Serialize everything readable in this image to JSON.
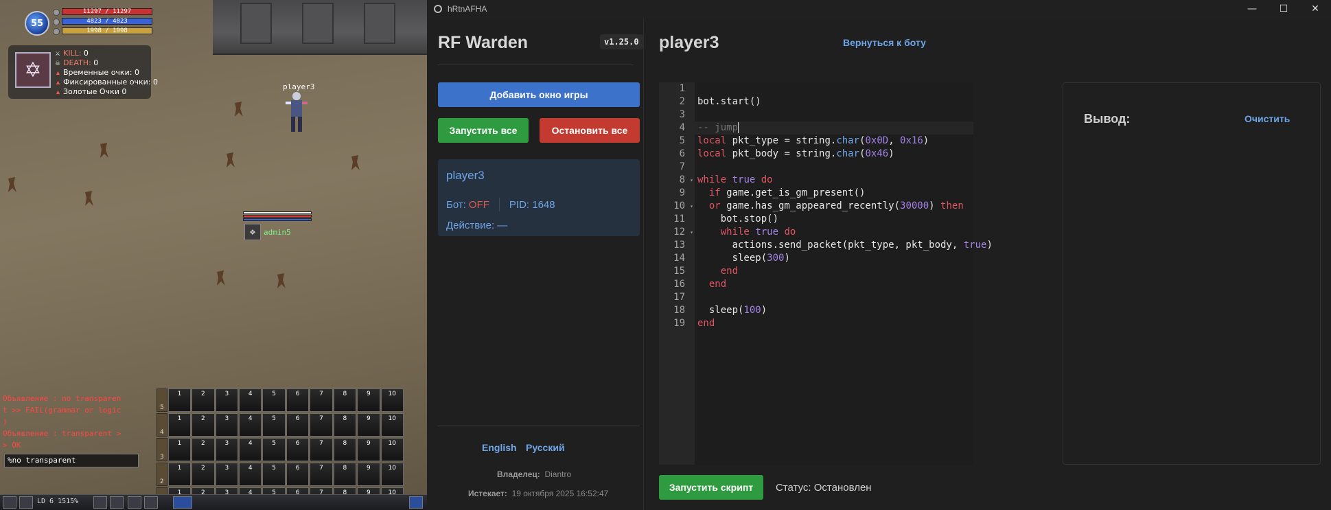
{
  "game": {
    "level": "55",
    "hp": "11297 / 11297",
    "fp": "4823 / 4823",
    "sp": "1998 / 1998",
    "stats": [
      {
        "label": "KILL:",
        "value": "0"
      },
      {
        "label": "DEATH:",
        "value": "0"
      },
      {
        "label": "Временные очки:",
        "value": "0"
      },
      {
        "label": "Фиксированные очки:",
        "value": "0"
      },
      {
        "label": "Золотые Очки",
        "value": "0"
      }
    ],
    "player_name": "player3",
    "admin_name": "admin5",
    "chat_lines": [
      "Объявление : no transparen",
      "t >> FAIL(grammar or logic",
      ")",
      "Объявление : transparent >",
      "> OK"
    ],
    "chat_input": "%no transparent",
    "hotbar_rows": [
      "5",
      "4",
      "3",
      "2",
      "1"
    ],
    "hotbar_slots": [
      "1",
      "2",
      "3",
      "4",
      "5",
      "6",
      "7",
      "8",
      "9",
      "10"
    ],
    "bottom_text": "LD 6 1515%"
  },
  "window": {
    "title": "hRtnAFHA",
    "controls": {
      "minimize": "—",
      "maximize": "☐",
      "close": "✕"
    }
  },
  "sidebar": {
    "brand": "RF Warden",
    "version": "v1.25.0",
    "add_window": "Добавить окно игры",
    "start_all": "Запустить все",
    "stop_all": "Остановить все",
    "card": {
      "name": "player3",
      "bot_label": "Бот:",
      "bot_state": "OFF",
      "pid_label": "PID: 1648",
      "action_label": "Действие: —"
    },
    "lang_en": "English",
    "lang_ru": "Русский",
    "owner_label": "Владелец:",
    "owner_value": "Diantro",
    "expires_label": "Истекает:",
    "expires_value": "19 октября 2025 16:52:47"
  },
  "main": {
    "heading": "player3",
    "back_link": "Вернуться к боту",
    "line_numbers": [
      "1",
      "2",
      "3",
      "4",
      "5",
      "6",
      "7",
      "8",
      "9",
      "10",
      "11",
      "12",
      "13",
      "14",
      "15",
      "16",
      "17",
      "18",
      "19"
    ],
    "output_title": "Вывод:",
    "clear": "Очистить",
    "run_script": "Запустить скрипт",
    "status": "Статус: Остановлен"
  },
  "colors": {
    "accent_blue": "#3c72c9",
    "green": "#2f9b41",
    "red": "#c33b30",
    "link": "#6ea5e8"
  }
}
